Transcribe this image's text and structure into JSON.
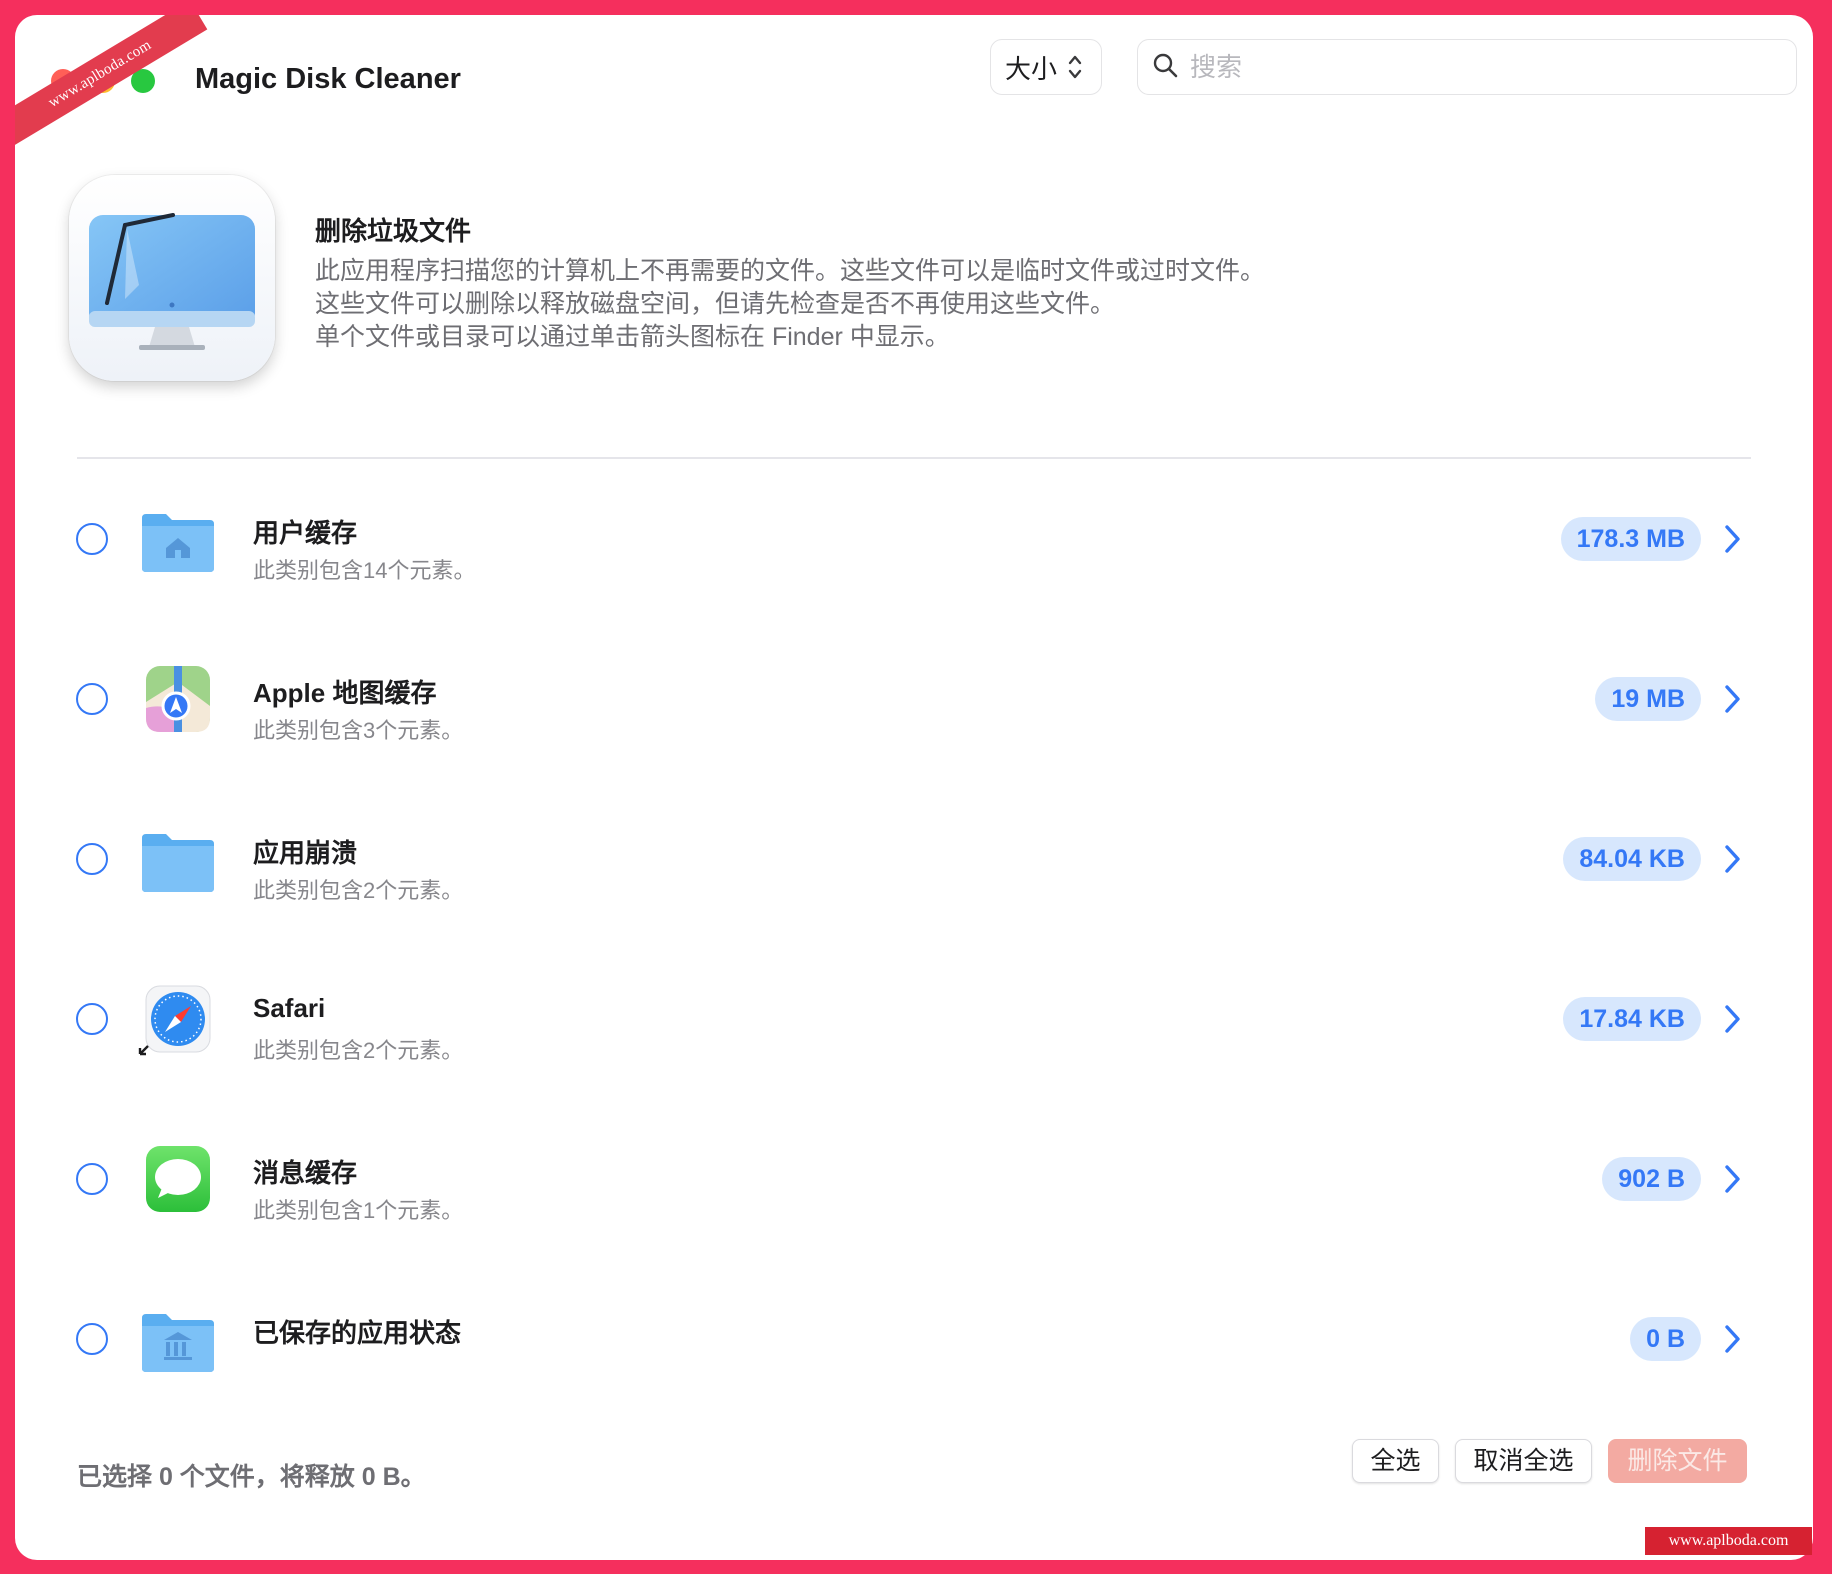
{
  "app": {
    "title": "Magic Disk Cleaner"
  },
  "toolbar": {
    "sort_label": "大小",
    "search_placeholder": "搜索"
  },
  "header": {
    "title": "删除垃圾文件",
    "description": [
      "此应用程序扫描您的计算机上不再需要的文件。这些文件可以是临时文件或过时文件。",
      "这些文件可以删除以释放磁盘空间，但请先检查是否不再使用这些文件。",
      "单个文件或目录可以通过单击箭头图标在 Finder 中显示。"
    ]
  },
  "categories": [
    {
      "name": "用户缓存",
      "subtitle": "此类别包含14个元素。",
      "size": "178.3 MB",
      "icon": "home-folder-icon",
      "selected": false
    },
    {
      "name": "Apple 地图缓存",
      "subtitle": "此类别包含3个元素。",
      "size": "19 MB",
      "icon": "maps-icon",
      "selected": false
    },
    {
      "name": "应用崩溃",
      "subtitle": "此类别包含2个元素。",
      "size": "84.04 KB",
      "icon": "folder-icon",
      "selected": false
    },
    {
      "name": "Safari",
      "subtitle": "此类别包含2个元素。",
      "size": "17.84 KB",
      "icon": "safari-icon",
      "selected": false
    },
    {
      "name": "消息缓存",
      "subtitle": "此类别包含1个元素。",
      "size": "902 B",
      "icon": "messages-icon",
      "selected": false
    },
    {
      "name": "已保存的应用状态",
      "subtitle": "",
      "size": "0 B",
      "icon": "library-folder-icon",
      "selected": false
    }
  ],
  "footer": {
    "status": "已选择 0 个文件，将释放 0 B。",
    "select_all": "全选",
    "deselect_all": "取消全选",
    "delete_files": "删除文件"
  },
  "watermarks": {
    "ribbon": "www.aplboda.com",
    "corner": "www.aplboda.com"
  },
  "colors": {
    "accent": "#3478f6",
    "size_pill_bg": "#d7e7fd",
    "delete_disabled": "#f3aaa2",
    "frame": "#f52f5d"
  }
}
